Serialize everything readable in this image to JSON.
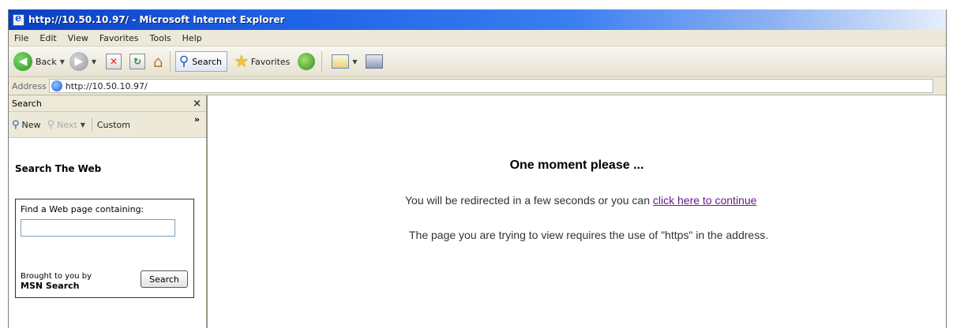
{
  "window": {
    "title": "http://10.50.10.97/ - Microsoft Internet Explorer"
  },
  "menu": [
    "File",
    "Edit",
    "View",
    "Favorites",
    "Tools",
    "Help"
  ],
  "toolbar": {
    "back_label": "Back",
    "search_label": "Search",
    "favorites_label": "Favorites",
    "icons": [
      "back-icon",
      "forward-icon",
      "stop-icon",
      "refresh-icon",
      "home-icon",
      "search-icon",
      "favorites-icon",
      "media-icon",
      "mail-icon",
      "print-icon"
    ]
  },
  "address": {
    "label": "Address",
    "url": "http://10.50.10.97/"
  },
  "sidebar": {
    "title": "Search",
    "close_glyph": "×",
    "new_label": "New",
    "next_label": "Next",
    "customize_label": "Custom",
    "more_glyph": "»",
    "section_title": "Search The Web",
    "find_label": "Find a Web page containing:",
    "find_value": "",
    "brought_label": "Brought to you by",
    "brand": "MSN Search",
    "search_button": "Search"
  },
  "content": {
    "headline": "One moment please ...",
    "redirect_text": "You will be redirected in a few seconds or you can ",
    "redirect_link": "click here to continue",
    "requires_text": "The page you are trying to view requires the use of \"https\" in the address."
  },
  "colors": {
    "titlebar": "#1f63e6",
    "chrome": "#ece9d8",
    "link_visited": "#6b1a8a"
  }
}
